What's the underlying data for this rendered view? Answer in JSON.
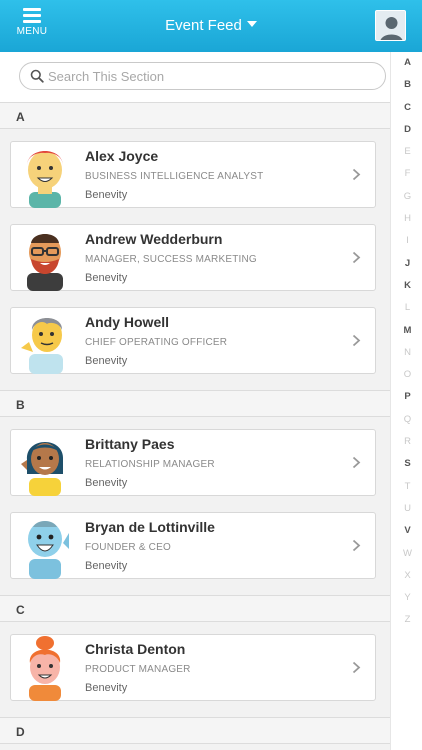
{
  "header": {
    "menu_label": "MENU",
    "title": "Event Feed"
  },
  "search": {
    "placeholder": "Search This Section"
  },
  "sections": [
    {
      "letter": "A",
      "people": [
        {
          "name": "Alex Joyce",
          "role": "BUSINESS INTELLIGENCE ANALYST",
          "company": "Benevity"
        },
        {
          "name": "Andrew Wedderburn",
          "role": "MANAGER, SUCCESS MARKETING",
          "company": "Benevity"
        },
        {
          "name": "Andy Howell",
          "role": "CHIEF OPERATING OFFICER",
          "company": "Benevity"
        }
      ]
    },
    {
      "letter": "B",
      "people": [
        {
          "name": "Brittany Paes",
          "role": "RELATIONSHIP MANAGER",
          "company": "Benevity"
        },
        {
          "name": "Bryan de Lottinville",
          "role": "FOUNDER & CEO",
          "company": "Benevity"
        }
      ]
    },
    {
      "letter": "C",
      "people": [
        {
          "name": "Christa Denton",
          "role": "PRODUCT MANAGER",
          "company": "Benevity"
        }
      ]
    },
    {
      "letter": "D",
      "people": []
    }
  ],
  "alpha_index": [
    {
      "l": "A",
      "on": true
    },
    {
      "l": "B",
      "on": true
    },
    {
      "l": "C",
      "on": true
    },
    {
      "l": "D",
      "on": true
    },
    {
      "l": "E",
      "on": false
    },
    {
      "l": "F",
      "on": false
    },
    {
      "l": "G",
      "on": false
    },
    {
      "l": "H",
      "on": false
    },
    {
      "l": "I",
      "on": false
    },
    {
      "l": "J",
      "on": true
    },
    {
      "l": "K",
      "on": true
    },
    {
      "l": "L",
      "on": false
    },
    {
      "l": "M",
      "on": true
    },
    {
      "l": "N",
      "on": false
    },
    {
      "l": "O",
      "on": false
    },
    {
      "l": "P",
      "on": true
    },
    {
      "l": "Q",
      "on": false
    },
    {
      "l": "R",
      "on": false
    },
    {
      "l": "S",
      "on": true
    },
    {
      "l": "T",
      "on": false
    },
    {
      "l": "U",
      "on": false
    },
    {
      "l": "V",
      "on": true
    },
    {
      "l": "W",
      "on": false
    },
    {
      "l": "X",
      "on": false
    },
    {
      "l": "Y",
      "on": false
    },
    {
      "l": "Z",
      "on": false
    }
  ],
  "colors": {
    "header": "#1fb0e0",
    "background": "#f2f2f2"
  }
}
